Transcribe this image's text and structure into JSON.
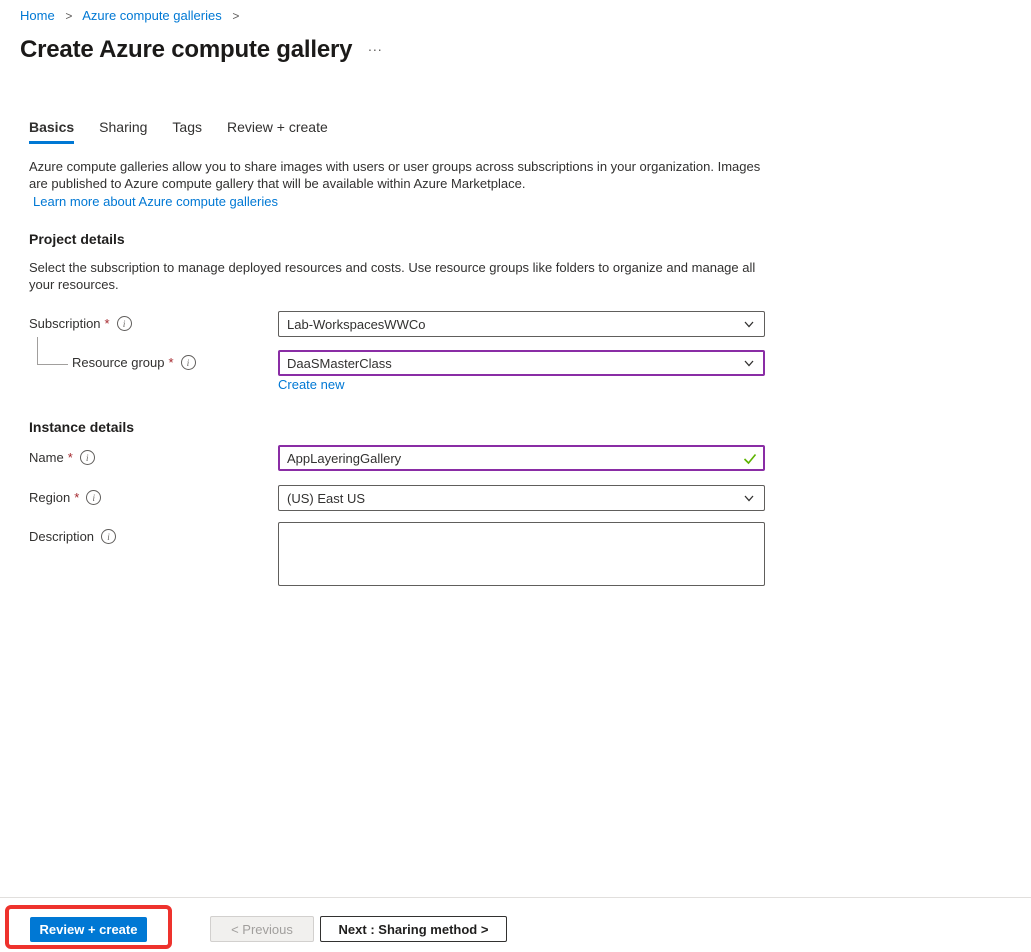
{
  "breadcrumb": {
    "separator": ">",
    "items": [
      {
        "label": "Home"
      },
      {
        "label": "Azure compute galleries"
      }
    ]
  },
  "header": {
    "title": "Create Azure compute gallery",
    "more": "..."
  },
  "tabs": [
    {
      "label": "Basics",
      "active": true
    },
    {
      "label": "Sharing",
      "active": false
    },
    {
      "label": "Tags",
      "active": false
    },
    {
      "label": "Review + create",
      "active": false
    }
  ],
  "intro": {
    "text": "Azure compute galleries allow you to share images with users or user groups across subscriptions in your organization. Images are published to Azure compute gallery that will be available within Azure Marketplace.",
    "learn_more_label": "Learn more about Azure compute galleries"
  },
  "project_details": {
    "heading": "Project details",
    "description": "Select the subscription to manage deployed resources and costs. Use resource groups like folders to organize and manage all your resources.",
    "subscription": {
      "label": "Subscription",
      "required_mark": "*",
      "value": "Lab-WorkspacesWWCo"
    },
    "resource_group": {
      "label": "Resource group",
      "required_mark": "*",
      "value": "DaaSMasterClass",
      "create_new_label": "Create new"
    }
  },
  "instance_details": {
    "heading": "Instance details",
    "name": {
      "label": "Name",
      "required_mark": "*",
      "value": "AppLayeringGallery",
      "validation": "valid"
    },
    "region": {
      "label": "Region",
      "required_mark": "*",
      "value": "(US) East US"
    },
    "description": {
      "label": "Description",
      "value": ""
    }
  },
  "footer": {
    "review_create_label": "Review + create",
    "previous_label": "< Previous",
    "next_label": "Next : Sharing method >"
  },
  "icons": {
    "info": "i",
    "chevron_down": "chevron-down",
    "valid_check": "check",
    "breadcrumb_separator": ">"
  },
  "colors": {
    "accent_blue": "#0078d4",
    "link_blue": "#0078d4",
    "required_red": "#a4262c",
    "modified_purple": "#8a2da5",
    "valid_green": "#5db300",
    "annotation_red": "#ee322d",
    "disabled_text": "#a19f9d"
  }
}
